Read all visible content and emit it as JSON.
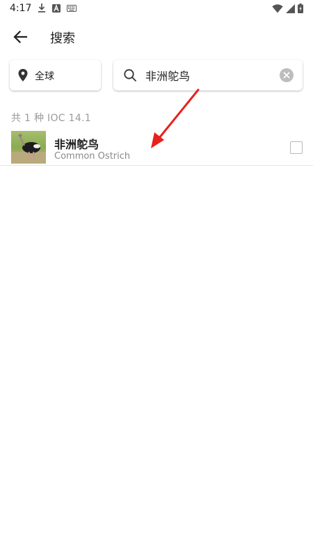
{
  "status_bar": {
    "time": "4:17",
    "left_icons": [
      "download-icon",
      "a-notification-icon",
      "keyboard-icon"
    ],
    "right_icons": [
      "wifi-icon",
      "cell-signal-icon",
      "battery-icon"
    ]
  },
  "header": {
    "title": "搜索",
    "back_icon": "arrow-left-icon"
  },
  "filters": {
    "region_label": "全球",
    "search_value": "非洲鸵鸟",
    "search_placeholder": ""
  },
  "results": {
    "summary": "共 1 种 IOC 14.1",
    "items": [
      {
        "name_cn": "非洲鸵鸟",
        "name_en": "Common Ostrich",
        "thumbnail": "ostrich-photo",
        "checked": false
      }
    ]
  },
  "annotation": {
    "color": "#e8211b"
  },
  "colors": {
    "text_primary": "#1f1f1f",
    "text_secondary": "#8a8a8a",
    "clear_button": "#bdbdbd"
  }
}
